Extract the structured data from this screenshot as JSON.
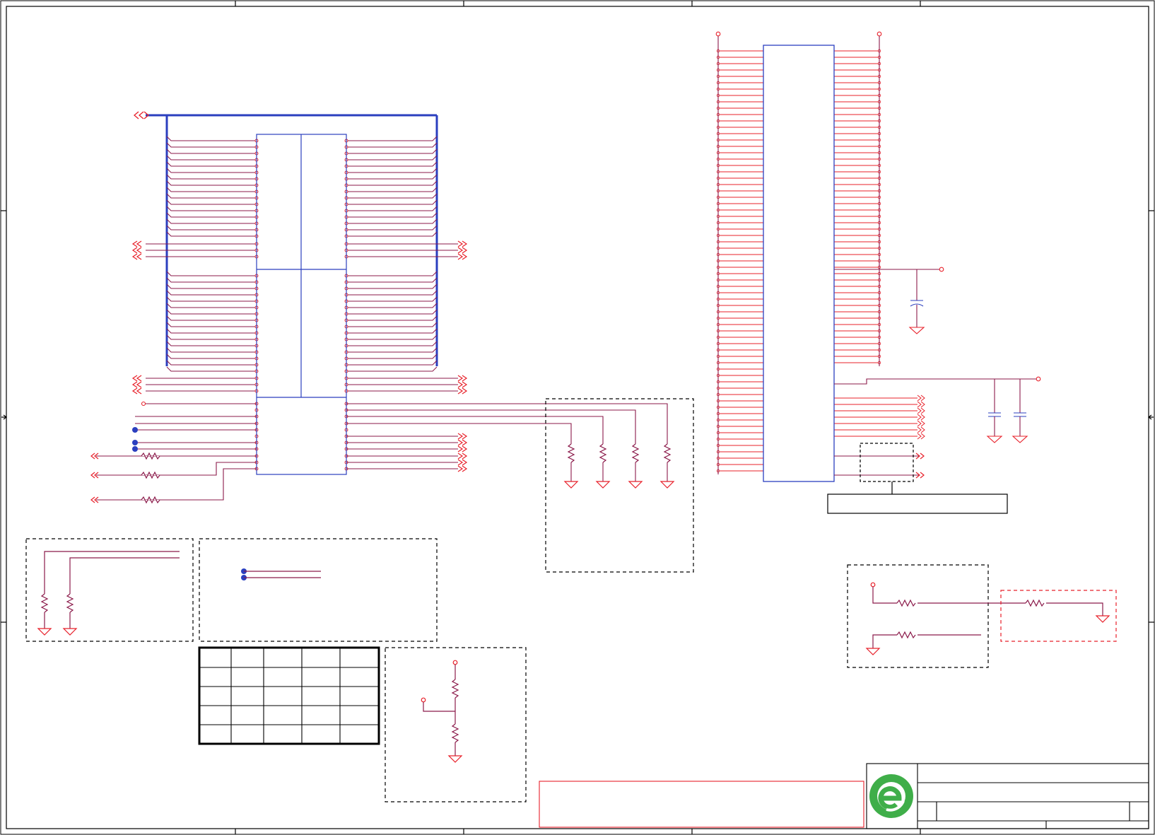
{
  "colors": {
    "wire": "#8b1a4a",
    "pin": "#e8202a",
    "body": "#2b3fbf",
    "frame": "#000000",
    "dash": "#000000",
    "junction": "#2b3fbf",
    "logo_green": "#3fae49"
  },
  "title_block": {
    "logo": "company-logo-icon"
  }
}
